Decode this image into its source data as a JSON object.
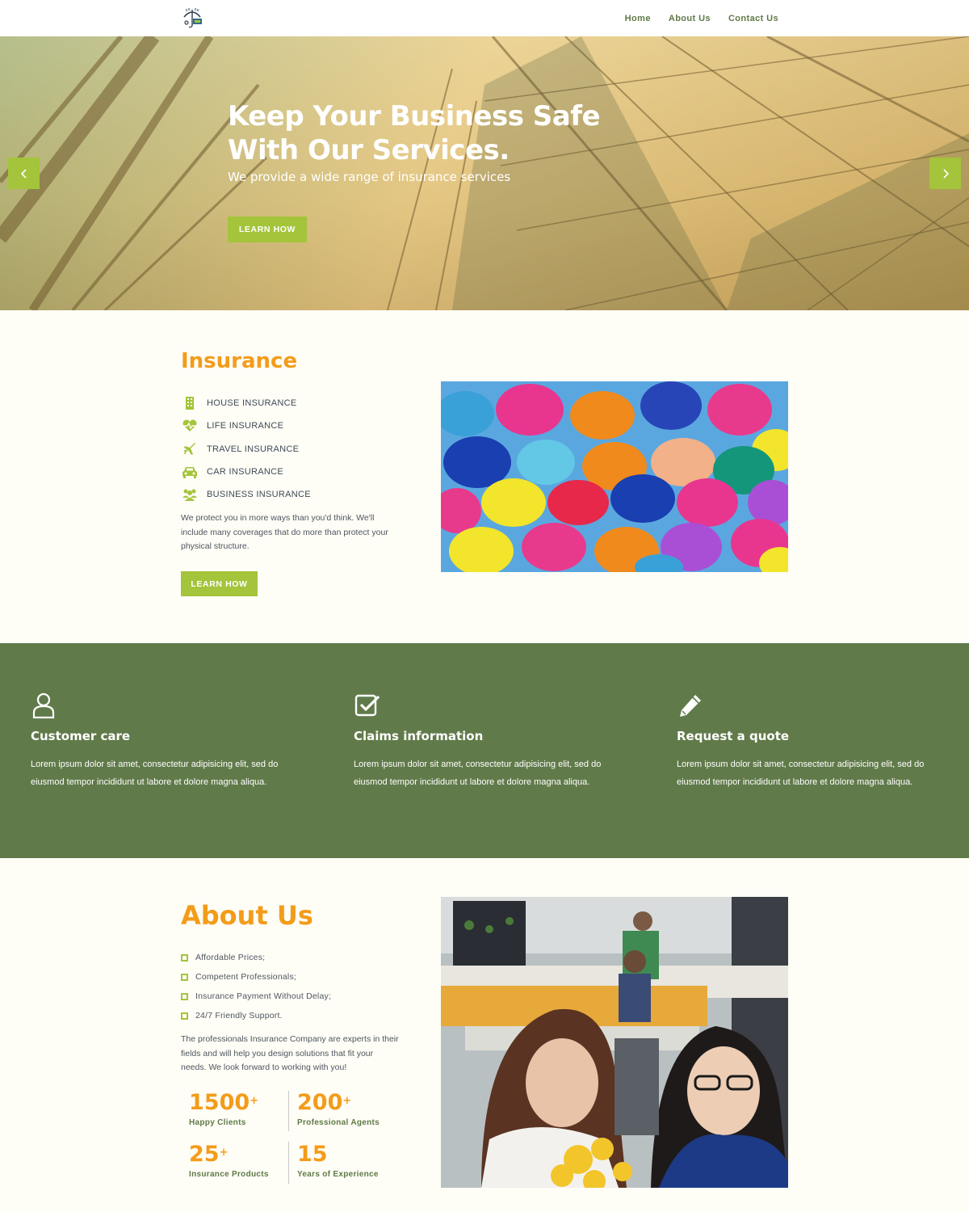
{
  "header": {
    "logo_icon": "umbrella-shield-logo-icon",
    "nav": [
      "Home",
      "About Us",
      "Contact Us"
    ]
  },
  "hero": {
    "title": "Keep Your Business Safe With Our Services.",
    "subtitle": "We provide a wide range of insurance services",
    "button": "LEARN HOW",
    "prev_icon": "chevron-left-icon",
    "next_icon": "chevron-right-icon"
  },
  "insurance": {
    "title": "Insurance",
    "items": [
      {
        "icon": "building-icon",
        "label": "HOUSE INSURANCE"
      },
      {
        "icon": "heartbeat-icon",
        "label": "LIFE INSURANCE"
      },
      {
        "icon": "plane-icon",
        "label": "TRAVEL INSURANCE"
      },
      {
        "icon": "car-icon",
        "label": "CAR INSURANCE"
      },
      {
        "icon": "users-icon",
        "label": "BUSINESS INSURANCE"
      }
    ],
    "text": "We protect you in more ways than you'd think. We'll include many coverages that do more than protect your physical structure.",
    "button": "LEARN HOW"
  },
  "features": [
    {
      "icon": "user-icon",
      "title": "Customer care",
      "text": "Lorem ipsum dolor sit amet, consectetur adipisicing elit, sed do eiusmod tempor incididunt ut labore et dolore magna aliqua."
    },
    {
      "icon": "checkbox-icon",
      "title": "Claims information",
      "text": "Lorem ipsum dolor sit amet, consectetur adipisicing elit, sed do eiusmod tempor incididunt ut labore et dolore magna aliqua."
    },
    {
      "icon": "pencil-icon",
      "title": "Request a quote",
      "text": "Lorem ipsum dolor sit amet, consectetur adipisicing elit, sed do eiusmod tempor incididunt ut labore et dolore magna aliqua."
    }
  ],
  "about": {
    "title": "About Us",
    "items": [
      "Affordable Prices;",
      "Competent Professionals;",
      "Insurance Payment Without Delay;",
      "24/7 Friendly Support."
    ],
    "text": "The professionals Insurance Company are experts in their fields and will help you design solutions that fit your needs. We look forward to working with you!",
    "stats": [
      {
        "value": "1500",
        "suffix": "+",
        "label": "Happy Clients"
      },
      {
        "value": "200",
        "suffix": "+",
        "label": "Professional Agents"
      },
      {
        "value": "25",
        "suffix": "+",
        "label": "Insurance Products"
      },
      {
        "value": "15",
        "suffix": "",
        "label": "Years of Experience"
      }
    ]
  },
  "colors": {
    "accent": "#a4c43b",
    "orange": "#f39c1a",
    "band": "#617a4a",
    "nav": "#5f7a46"
  }
}
